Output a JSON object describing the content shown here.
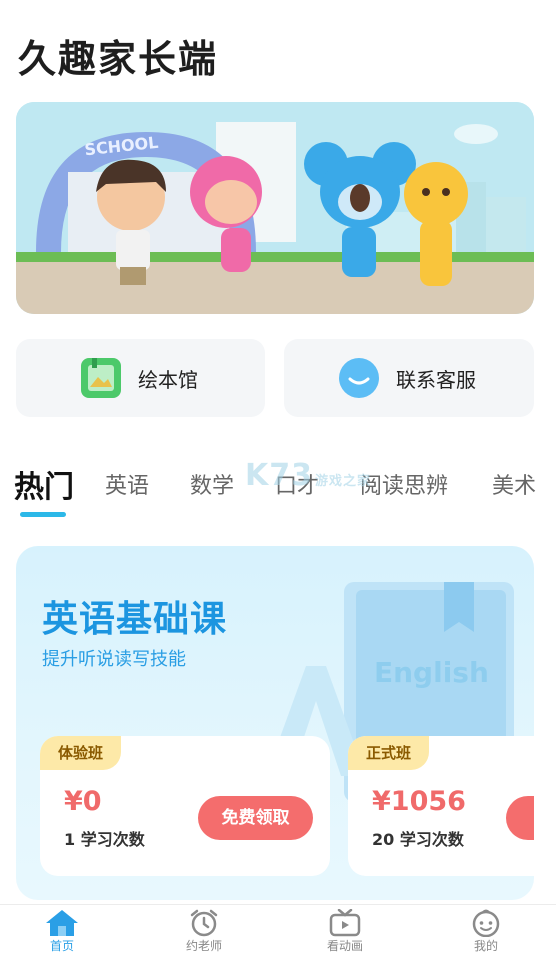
{
  "app": {
    "title": "久趣家长端"
  },
  "banner": {
    "school_sign": "SCHOOL"
  },
  "quick_links": [
    {
      "label": "绘本馆",
      "icon": "picture-book-icon"
    },
    {
      "label": "联系客服",
      "icon": "chat-bubble-icon"
    }
  ],
  "tabs": [
    {
      "label": "热门",
      "active": true
    },
    {
      "label": "英语"
    },
    {
      "label": "数学"
    },
    {
      "label": "口才"
    },
    {
      "label": "阅读思辨"
    },
    {
      "label": "美术"
    }
  ],
  "course": {
    "title": "英语基础课",
    "subtitle": "提升听说读写技能",
    "book_label": "English",
    "plans": [
      {
        "tag": "体验班",
        "price": "¥0",
        "count": "1 学习次数",
        "button": "免费领取"
      },
      {
        "tag": "正式班",
        "price": "¥1056",
        "count": "20 学习次数",
        "button": ""
      }
    ]
  },
  "watermark": {
    "text": "K73",
    "sub": "游戏之家"
  },
  "bottom_nav": [
    {
      "label": "首页",
      "icon": "home-icon",
      "active": true
    },
    {
      "label": "约老师",
      "icon": "alarm-clock-icon"
    },
    {
      "label": "看动画",
      "icon": "tv-icon"
    },
    {
      "label": "我的",
      "icon": "baby-face-icon"
    }
  ],
  "colors": {
    "accent": "#2cb8e8",
    "price": "#f06a6a",
    "course_title": "#1c95e0",
    "tag_bg": "#fde9a8"
  }
}
